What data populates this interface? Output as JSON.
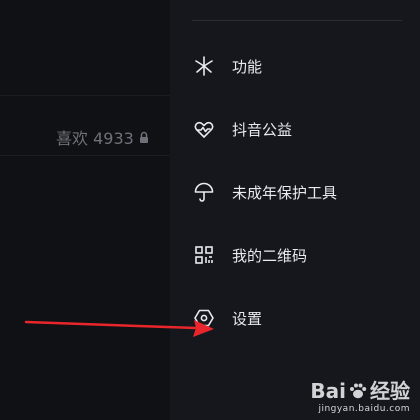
{
  "left": {
    "likes_text": "喜欢 4933"
  },
  "drawer": {
    "items": [
      {
        "label": "功能",
        "icon": "sparkle-icon"
      },
      {
        "label": "抖音公益",
        "icon": "heart-hand-icon"
      },
      {
        "label": "未成年保护工具",
        "icon": "umbrella-icon"
      },
      {
        "label": "我的二维码",
        "icon": "qr-code-icon"
      },
      {
        "label": "设置",
        "icon": "gear-hexagon-icon"
      }
    ]
  },
  "annotation": {
    "arrow_color": "#e8262b"
  },
  "watermark": {
    "brand": "Bai",
    "brand_suffix": "经验",
    "url": "jingyan.baidu.com"
  },
  "colors": {
    "drawer_bg": "#16171d",
    "left_bg": "#101115",
    "text": "#e9e9ee",
    "muted": "#6f7178"
  }
}
